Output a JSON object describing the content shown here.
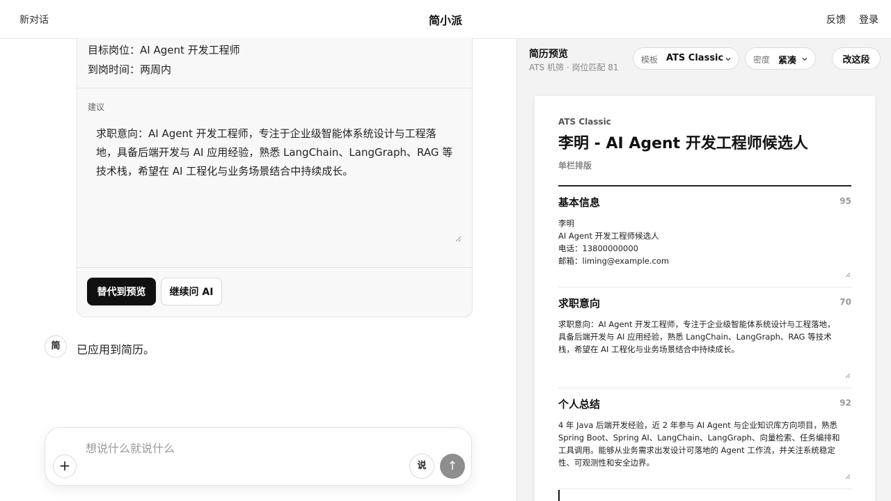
{
  "header": {
    "new_chat": "新对话",
    "app_title": "简小派",
    "feedback": "反馈",
    "login": "登录"
  },
  "chat": {
    "card": {
      "target_position": "目标岗位：AI Agent 开发工程师",
      "arrival_time": "到岗时间：两周内",
      "suggestion_label": "建议",
      "suggestion_text": "求职意向：AI Agent 开发工程师，专注于企业级智能体系统设计与工程落地，具备后端开发与 AI 应用经验，熟悉 LangChain、LangGraph、RAG 等技术栈，希望在 AI 工程化与业务场景结合中持续成长。",
      "replace_button": "替代到预览",
      "ask_button": "继续问 AI"
    },
    "assistant_avatar": "简",
    "applied_message": "已应用到简历。",
    "composer": {
      "placeholder": "想说什么就说什么",
      "plus": "+",
      "voice": "说",
      "send": "↑"
    }
  },
  "preview": {
    "title": "简历预览",
    "subtitle": "ATS 机筛 · 岗位匹配 81",
    "template_label": "模板",
    "template_value": "ATS Classic",
    "density_label": "密度",
    "density_value": "紧凑",
    "edit_button": "改这段",
    "resume": {
      "template_name": "ATS Classic",
      "headline": "李明 - AI Agent 开发工程师候选人",
      "layout": "单栏排版",
      "sections": [
        {
          "title": "基本信息",
          "score": "95",
          "lines": [
            "李明",
            "AI Agent 开发工程师候选人",
            "电话：13800000000",
            "邮箱：liming@example.com"
          ]
        },
        {
          "title": "求职意向",
          "score": "70",
          "lines": [
            "求职意向：AI Agent 开发工程师，专注于企业级智能体系统设计与工程落地，",
            "具备后端开发与 AI 应用经验，熟悉 LangChain、LangGraph、RAG 等技术",
            "栈，希望在 AI 工程化与业务场景结合中持续成长。"
          ]
        },
        {
          "title": "个人总结",
          "score": "92",
          "lines": [
            "4 年 Java 后端开发经验，近 2 年参与 AI Agent 与企业知识库方向项目，熟悉",
            "Spring Boot、Spring AI、LangChain、LangGraph、向量检索、任务编排和",
            "工具调用。能够从业务需求出发设计可落地的 Agent 工作流，并关注系统稳定",
            "性、可观测性和安全边界。"
          ]
        }
      ]
    }
  }
}
